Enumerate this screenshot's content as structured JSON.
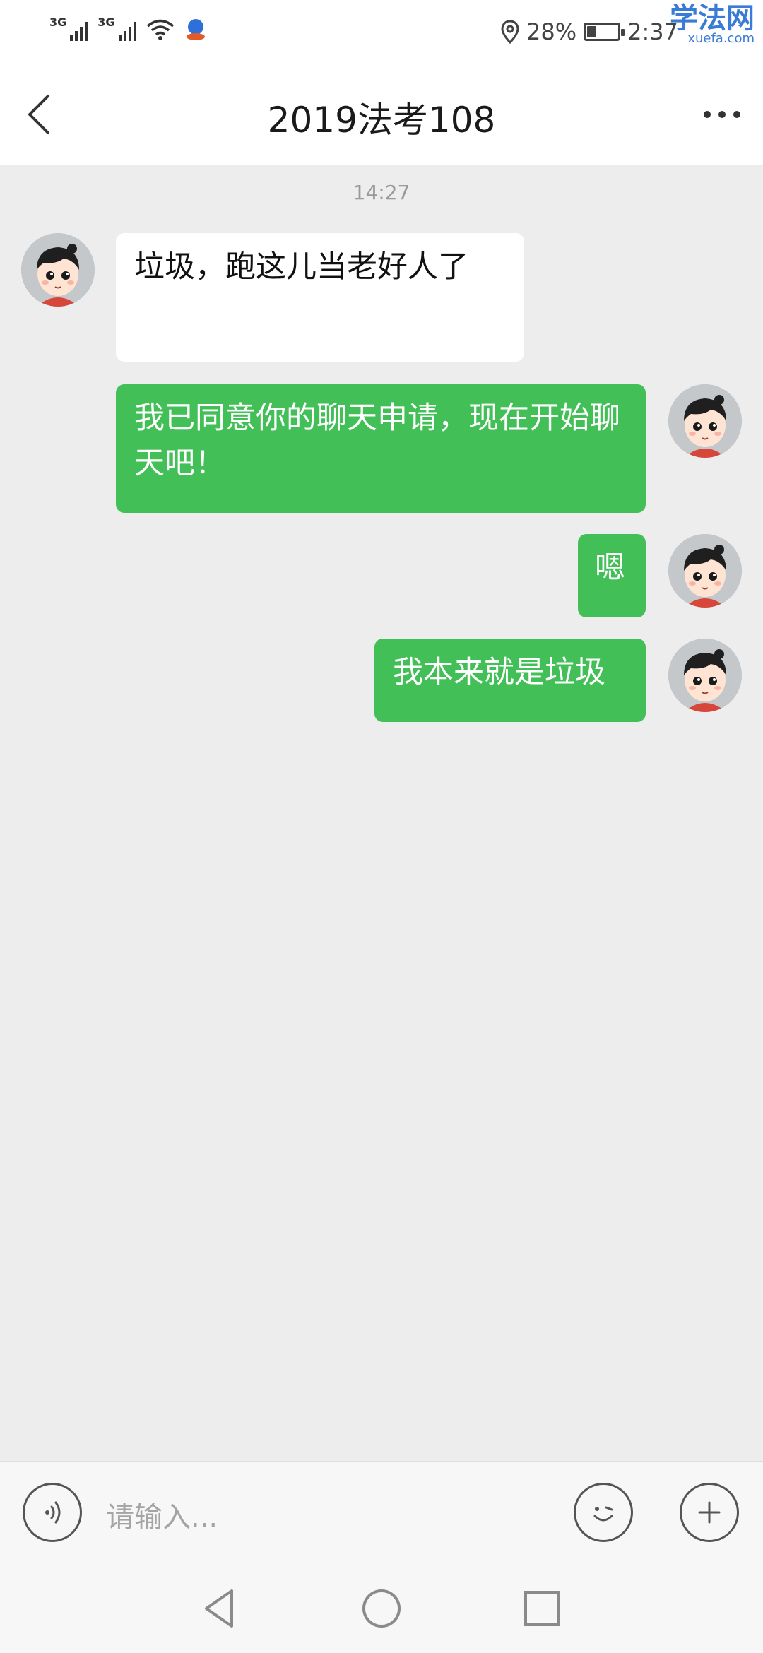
{
  "status_bar": {
    "signal1_label": "3G",
    "signal2_label": "3G",
    "battery_percent": "28%",
    "battery_level": 0.28,
    "time": "2:37",
    "watermark_title": "学法网",
    "watermark_url": "xuefa.com"
  },
  "header": {
    "title": "2019法考108",
    "back_icon": "chevron-left-icon",
    "more_icon": "more-horizontal-icon"
  },
  "chat": {
    "timestamp": "14:27",
    "messages": [
      {
        "direction": "in",
        "text": "垃圾，跑这儿当老好人了"
      },
      {
        "direction": "out",
        "text": "我已同意你的聊天申请，现在开始聊天吧！"
      },
      {
        "direction": "out",
        "text": "嗯"
      },
      {
        "direction": "out",
        "text": "我本来就是垃圾"
      }
    ]
  },
  "input_bar": {
    "placeholder": "请输入...",
    "voice_icon": "voice-icon",
    "emoji_icon": "emoji-icon",
    "add_icon": "plus-icon"
  },
  "nav_bar": {
    "back_icon": "triangle-back-icon",
    "home_icon": "circle-home-icon",
    "recent_icon": "square-recent-icon"
  },
  "colors": {
    "bubble_out": "#43bf58",
    "bubble_in": "#ffffff",
    "chat_background": "#ededed"
  }
}
